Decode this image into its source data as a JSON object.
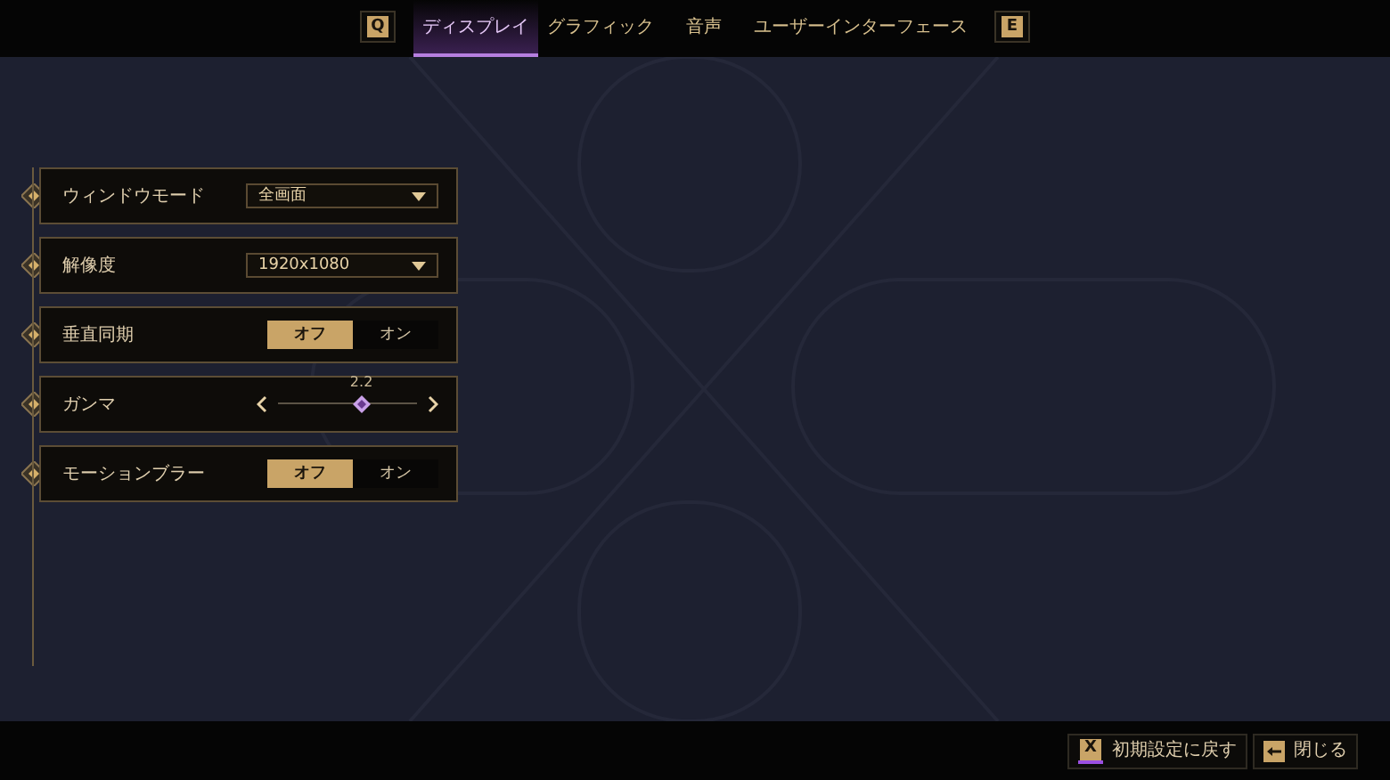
{
  "top_bar": {
    "prev_key": "Q",
    "next_key": "E",
    "tabs": [
      {
        "label": "ディスプレイ",
        "selected": true
      },
      {
        "label": "グラフィック",
        "selected": false
      },
      {
        "label": "音声",
        "selected": false
      },
      {
        "label": "ユーザーインターフェース",
        "selected": false
      }
    ]
  },
  "settings": [
    {
      "kind": "dropdown",
      "label": "ウィンドウモード",
      "value": "全画面"
    },
    {
      "kind": "dropdown",
      "label": "解像度",
      "value": "1920x1080"
    },
    {
      "kind": "toggle",
      "label": "垂直同期",
      "options": [
        {
          "label": "オフ",
          "selected": true
        },
        {
          "label": "オン",
          "selected": false
        }
      ]
    },
    {
      "kind": "slider",
      "label": "ガンマ",
      "reading": "2.2",
      "level": 0.6
    },
    {
      "kind": "toggle",
      "label": "モーションブラー",
      "options": [
        {
          "label": "オフ",
          "selected": true
        },
        {
          "label": "オン",
          "selected": false
        }
      ]
    }
  ],
  "footer": {
    "buttons": [
      {
        "kind": "key",
        "key": "X",
        "label": "初期設定に戻す"
      },
      {
        "kind": "arrow",
        "label": "閉じる"
      }
    ]
  }
}
